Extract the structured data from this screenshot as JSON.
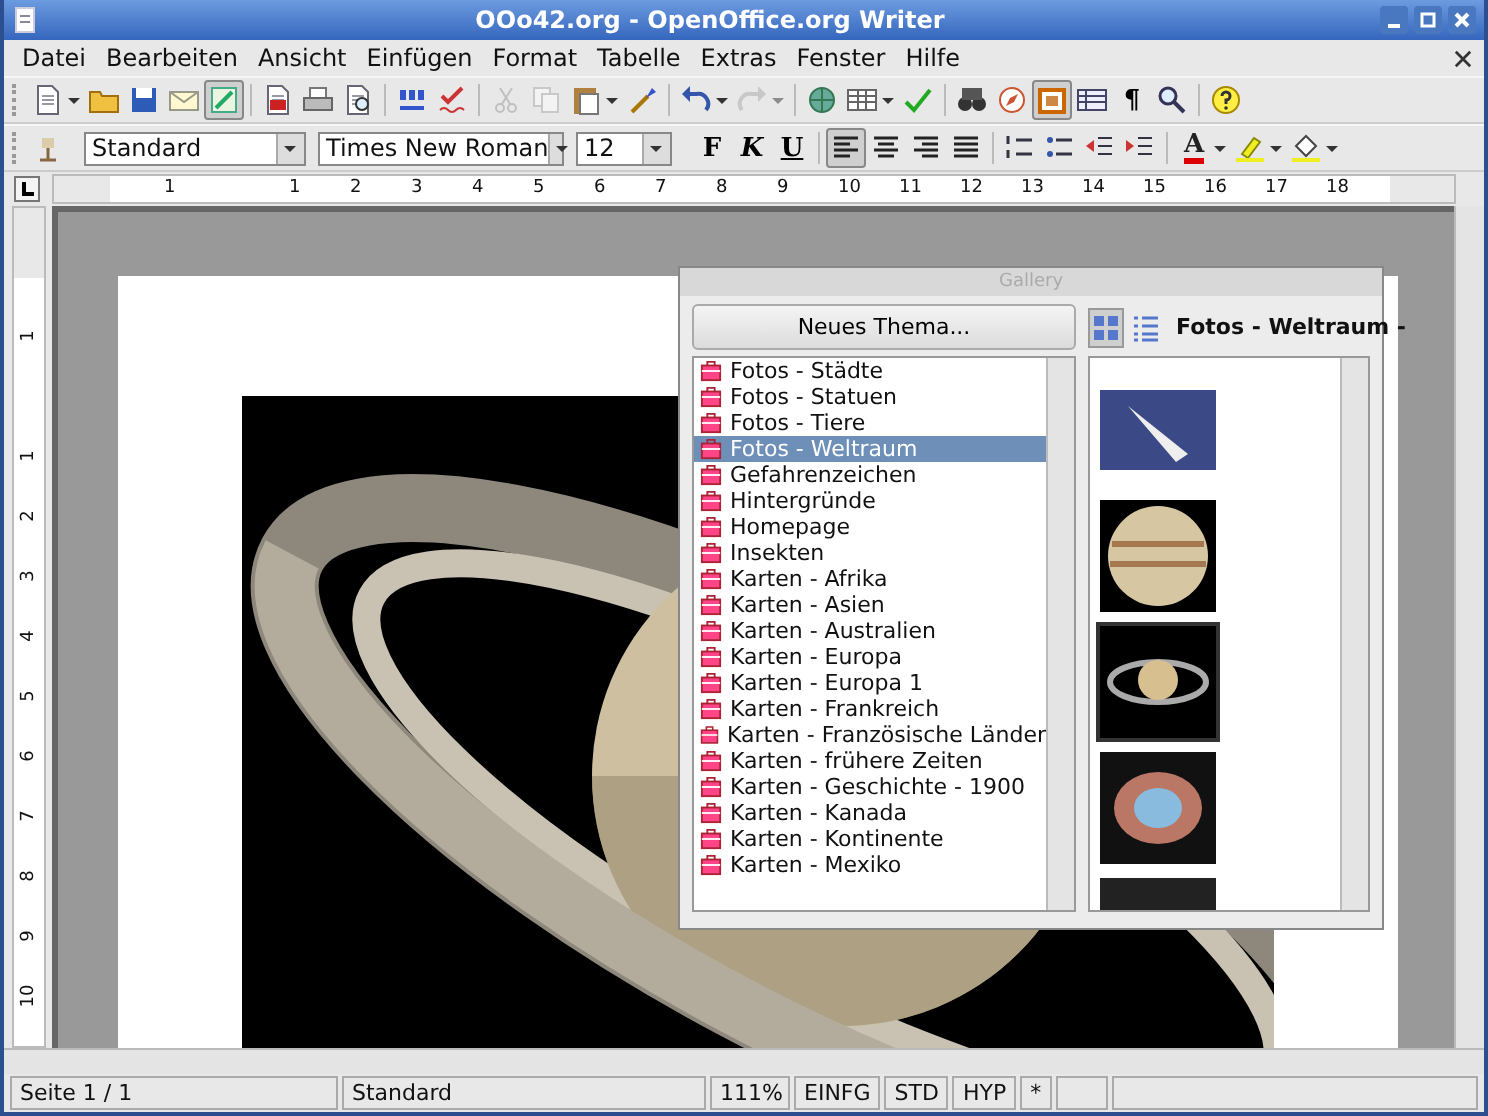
{
  "window": {
    "title": "OOo42.org - OpenOffice.org Writer"
  },
  "menu": [
    "Datei",
    "Bearbeiten",
    "Ansicht",
    "Einfügen",
    "Format",
    "Tabelle",
    "Extras",
    "Fenster",
    "Hilfe"
  ],
  "standard_toolbar": [
    {
      "kind": "new",
      "dropdown": true,
      "pressed": false,
      "disabled": false
    },
    {
      "kind": "open",
      "dropdown": false,
      "pressed": false,
      "disabled": false
    },
    {
      "kind": "save",
      "dropdown": false,
      "pressed": false,
      "disabled": false
    },
    {
      "kind": "mail",
      "dropdown": false,
      "pressed": false,
      "disabled": false
    },
    {
      "kind": "edit",
      "dropdown": false,
      "pressed": true,
      "disabled": false
    },
    {
      "kind": "separator"
    },
    {
      "kind": "pdf",
      "dropdown": false,
      "pressed": false,
      "disabled": false
    },
    {
      "kind": "print",
      "dropdown": false,
      "pressed": false,
      "disabled": false
    },
    {
      "kind": "preview",
      "dropdown": false,
      "pressed": false,
      "disabled": false
    },
    {
      "kind": "separator"
    },
    {
      "kind": "spelling",
      "dropdown": false,
      "pressed": false,
      "disabled": false
    },
    {
      "kind": "autospell",
      "dropdown": false,
      "pressed": false,
      "disabled": false
    },
    {
      "kind": "separator"
    },
    {
      "kind": "cut",
      "dropdown": false,
      "pressed": false,
      "disabled": true
    },
    {
      "kind": "copy",
      "dropdown": false,
      "pressed": false,
      "disabled": true
    },
    {
      "kind": "paste",
      "dropdown": true,
      "pressed": false,
      "disabled": false
    },
    {
      "kind": "brush",
      "dropdown": false,
      "pressed": false,
      "disabled": false
    },
    {
      "kind": "separator"
    },
    {
      "kind": "undo",
      "dropdown": true,
      "pressed": false,
      "disabled": false
    },
    {
      "kind": "redo",
      "dropdown": true,
      "pressed": false,
      "disabled": true
    },
    {
      "kind": "separator"
    },
    {
      "kind": "hyperlink",
      "dropdown": false,
      "pressed": false,
      "disabled": false
    },
    {
      "kind": "table",
      "dropdown": true,
      "pressed": false,
      "disabled": false
    },
    {
      "kind": "draw",
      "dropdown": false,
      "pressed": false,
      "disabled": false
    },
    {
      "kind": "separator"
    },
    {
      "kind": "find",
      "dropdown": false,
      "pressed": false,
      "disabled": false
    },
    {
      "kind": "navigator",
      "dropdown": false,
      "pressed": false,
      "disabled": false
    },
    {
      "kind": "gallery",
      "dropdown": false,
      "pressed": true,
      "disabled": false
    },
    {
      "kind": "datasource",
      "dropdown": false,
      "pressed": false,
      "disabled": false
    },
    {
      "kind": "pilcrow",
      "label": "¶",
      "dropdown": false,
      "pressed": false,
      "disabled": false
    },
    {
      "kind": "zoom",
      "dropdown": false,
      "pressed": false,
      "disabled": false
    },
    {
      "kind": "separator"
    },
    {
      "kind": "help",
      "dropdown": false,
      "pressed": false,
      "disabled": false
    }
  ],
  "formatting_toolbar": {
    "style": "Standard",
    "font": "Times New Roman",
    "size": "12",
    "buttons": [
      {
        "kind": "bold",
        "label": "F",
        "dropdown": false,
        "pressed": false
      },
      {
        "kind": "italic",
        "label": "K",
        "dropdown": false,
        "pressed": false
      },
      {
        "kind": "underline",
        "label": "U",
        "dropdown": false,
        "pressed": false
      },
      {
        "kind": "separator"
      },
      {
        "kind": "align-left",
        "dropdown": false,
        "pressed": true
      },
      {
        "kind": "align-center",
        "dropdown": false,
        "pressed": false
      },
      {
        "kind": "align-right",
        "dropdown": false,
        "pressed": false
      },
      {
        "kind": "justify",
        "dropdown": false,
        "pressed": false
      },
      {
        "kind": "separator"
      },
      {
        "kind": "numbering",
        "dropdown": false,
        "pressed": false
      },
      {
        "kind": "bullets",
        "dropdown": false,
        "pressed": false
      },
      {
        "kind": "indent-decrease",
        "dropdown": false,
        "pressed": false
      },
      {
        "kind": "indent-increase",
        "dropdown": false,
        "pressed": false
      },
      {
        "kind": "separator"
      },
      {
        "kind": "font-color",
        "label": "A",
        "dropdown": true,
        "pressed": false
      },
      {
        "kind": "highlight",
        "dropdown": true,
        "pressed": false
      },
      {
        "kind": "background",
        "dropdown": true,
        "pressed": false
      }
    ]
  },
  "ruler": {
    "labels": [
      "1",
      "1",
      "2",
      "3",
      "4",
      "5",
      "6",
      "7",
      "8",
      "9",
      "10",
      "11",
      "12",
      "13",
      "14",
      "15",
      "16",
      "17",
      "18"
    ]
  },
  "vertical_ruler": {
    "labels": [
      "1",
      "1",
      "2",
      "3",
      "4",
      "5",
      "6",
      "7",
      "8",
      "9",
      "10"
    ]
  },
  "gallery": {
    "title": "Gallery",
    "new_theme_button": "Neues Thema...",
    "theme_title": "Fotos - Weltraum -",
    "themes": [
      {
        "label": "Fotos - Städte",
        "selected": false
      },
      {
        "label": "Fotos - Statuen",
        "selected": false
      },
      {
        "label": "Fotos - Tiere",
        "selected": false
      },
      {
        "label": "Fotos - Weltraum",
        "selected": true
      },
      {
        "label": "Gefahrenzeichen",
        "selected": false
      },
      {
        "label": "Hintergründe",
        "selected": false
      },
      {
        "label": "Homepage",
        "selected": false
      },
      {
        "label": "Insekten",
        "selected": false
      },
      {
        "label": "Karten - Afrika",
        "selected": false
      },
      {
        "label": "Karten - Asien",
        "selected": false
      },
      {
        "label": "Karten - Australien",
        "selected": false
      },
      {
        "label": "Karten - Europa",
        "selected": false
      },
      {
        "label": "Karten - Europa 1",
        "selected": false
      },
      {
        "label": "Karten - Frankreich",
        "selected": false
      },
      {
        "label": "Karten - Französische Länder",
        "selected": false
      },
      {
        "label": "Karten - frühere Zeiten",
        "selected": false
      },
      {
        "label": "Karten - Geschichte - 1900",
        "selected": false
      },
      {
        "label": "Karten - Kanada",
        "selected": false
      },
      {
        "label": "Karten - Kontinente",
        "selected": false
      },
      {
        "label": "Karten - Mexiko",
        "selected": false
      }
    ],
    "view_modes": [
      {
        "kind": "icons",
        "selected": true
      },
      {
        "kind": "details",
        "selected": false
      }
    ],
    "thumbnails": [
      {
        "kind": "shuttle",
        "selected": false
      },
      {
        "kind": "banded-planet",
        "selected": false
      },
      {
        "kind": "ringed-planet",
        "selected": true
      },
      {
        "kind": "nebula",
        "selected": false
      },
      {
        "kind": "galaxy",
        "selected": false
      }
    ]
  },
  "status_bar": [
    "Seite 1 / 1",
    "Standard",
    "111%",
    "EINFG",
    "STD",
    "HYP",
    "*"
  ]
}
